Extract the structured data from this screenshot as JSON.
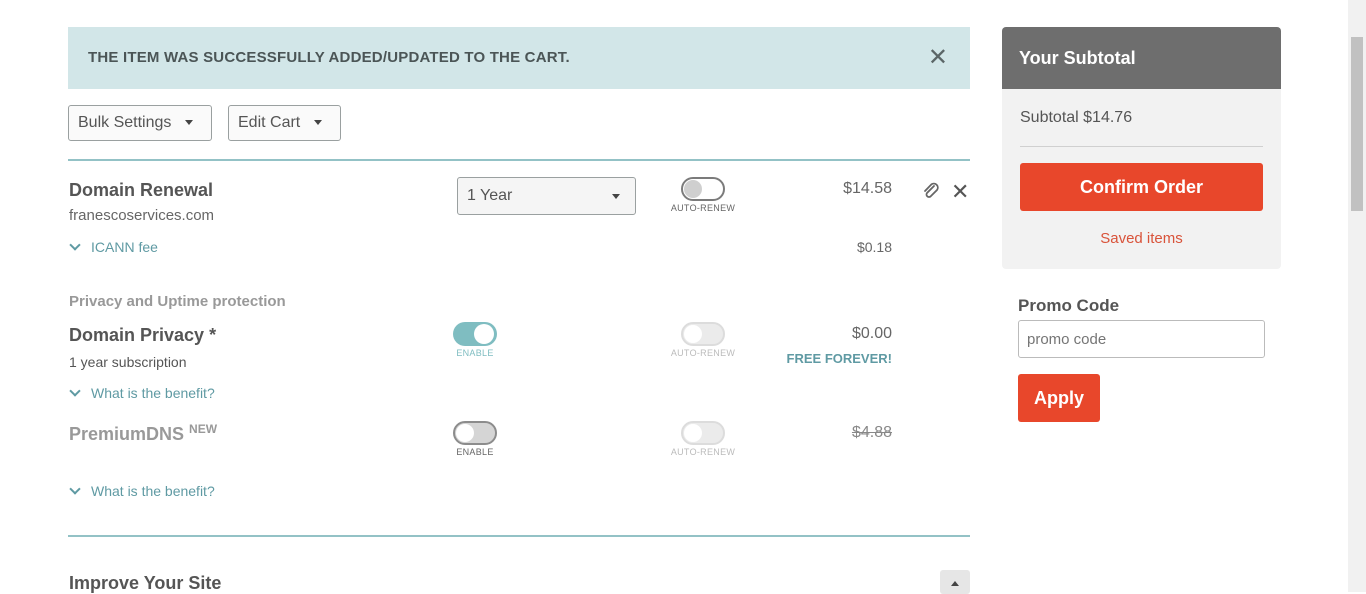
{
  "alert": {
    "message": "THE ITEM WAS SUCCESSFULLY ADDED/UPDATED TO THE CART.",
    "close_glyph": "✕"
  },
  "toolbar": {
    "bulk_settings": "Bulk Settings",
    "edit_cart": "Edit Cart"
  },
  "domain_renewal": {
    "title": "Domain Renewal",
    "domain": "franescoservices.com",
    "period": "1 Year",
    "auto_renew_label": "AUTO-RENEW",
    "auto_renew_on": false,
    "price": "$14.58",
    "icann_label": "ICANN fee",
    "icann_price": "$0.18"
  },
  "privacy": {
    "section_title": "Privacy and Uptime protection",
    "title": "Domain Privacy *",
    "subscription": "1 year subscription",
    "enable_label": "ENABLE",
    "enabled": true,
    "auto_renew_label": "AUTO-RENEW",
    "price": "$0.00",
    "free_label": "FREE FOREVER!",
    "benefit_label": "What is the benefit?"
  },
  "premium_dns": {
    "title": "PremiumDNS",
    "badge": "NEW",
    "enable_label": "ENABLE",
    "enabled": false,
    "auto_renew_label": "AUTO-RENEW",
    "price": "$4.88",
    "benefit_label": "What is the benefit?"
  },
  "improve": {
    "title": "Improve Your Site"
  },
  "sidebar": {
    "heading": "Your Subtotal",
    "subtotal": "Subtotal $14.76",
    "confirm": "Confirm Order",
    "saved": "Saved items",
    "promo_title": "Promo Code",
    "promo_placeholder": "promo code",
    "apply": "Apply"
  },
  "colors": {
    "accent_red": "#e8472b",
    "teal": "#7fbdc1",
    "alert_bg": "#d2e6e8"
  }
}
